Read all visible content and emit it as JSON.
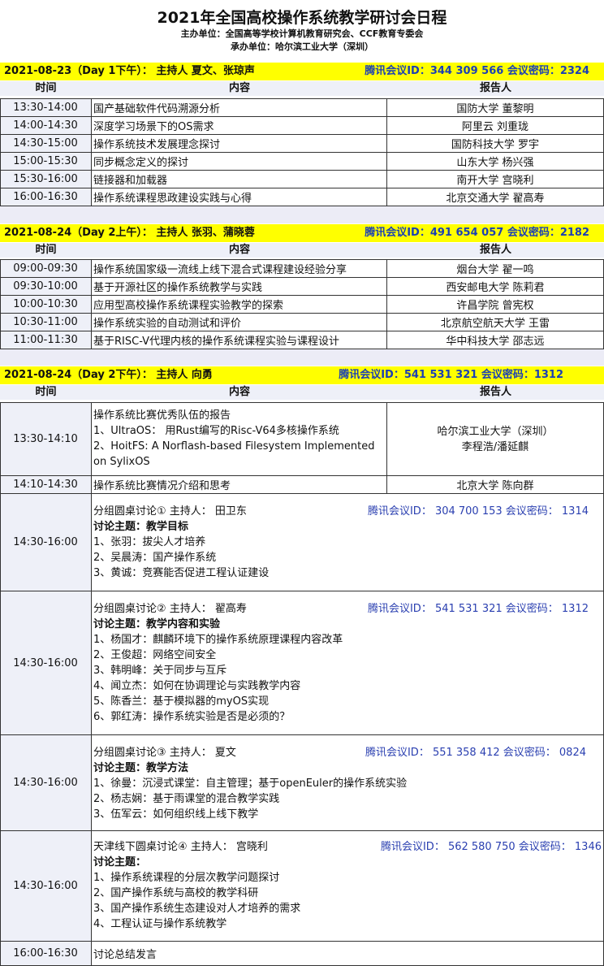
{
  "header": {
    "title": "2021年全国高校操作系统教学研讨会日程",
    "organizer": "主办单位：全国高等学校计算机教育研究会、CCF教育专委会",
    "host": "承办单位：哈尔滨工业大学（深圳）"
  },
  "columns": {
    "time": "时间",
    "content": "内容",
    "speaker": "报告人"
  },
  "sections": [
    {
      "title": "2021-08-23（Day 1下午）： 主持人 夏文、张琼声",
      "meeting": "腾讯会议ID：344 309 566  会议密码：2324",
      "rows": [
        {
          "time": "13:30-14:00",
          "content": "国产基础软件代码溯源分析",
          "speaker": "国防大学 董黎明"
        },
        {
          "time": "14:00-14:30",
          "content": "深度学习场景下的OS需求",
          "speaker": "阿里云 刘重珑"
        },
        {
          "time": "14:30-15:00",
          "content": "操作系统技术发展理念探讨",
          "speaker": "国防科技大学 罗宇"
        },
        {
          "time": "15:00-15:30",
          "content": "同步概念定义的探讨",
          "speaker": "山东大学 杨兴强"
        },
        {
          "time": "15:30-16:00",
          "content": "链接器和加载器",
          "speaker": "南开大学 宫晓利"
        },
        {
          "time": "16:00-16:30",
          "content": "操作系统课程思政建设实践与心得",
          "speaker": "北京交通大学 翟高寿"
        }
      ]
    },
    {
      "title": "2021-08-24（Day 2上午）： 主持人 张羽、蒲晓蓉",
      "meeting": "腾讯会议ID：491 654 057  会议密码：2182",
      "rows": [
        {
          "time": "09:00-09:30",
          "content": "操作系统国家级一流线上线下混合式课程建设经验分享",
          "speaker": "烟台大学 翟一鸣"
        },
        {
          "time": "09:30-10:00",
          "content": "基于开源社区的操作系统教学与实践",
          "speaker": "西安邮电大学 陈莉君"
        },
        {
          "time": "10:00-10:30",
          "content": "应用型高校操作系统课程实验教学的探索",
          "speaker": "许昌学院 曾宪权"
        },
        {
          "time": "10:30-11:00",
          "content": "操作系统实验的自动测试和评价",
          "speaker": "北京航空航天大学 王雷"
        },
        {
          "time": "11:00-11:30",
          "content": "基于RISC-V代理内核的操作系统课程实验与课程设计",
          "speaker": "华中科技大学 邵志远"
        }
      ]
    },
    {
      "title": "2021-08-24（Day 2下午）： 主持人 向勇",
      "meeting": "腾讯会议ID：541 531 321  会议密码：1312",
      "rows": [
        {
          "time": "13:30-14:10",
          "content_lines": [
            "操作系统比赛优秀队伍的报告",
            "1、UltraOS： 用Rust编写的Risc-V64多核操作系统",
            "2、HoitFS: A Norflash-based Filesystem Implemented",
            "on SylixOS"
          ],
          "speaker_lines": [
            "哈尔滨工业大学（深圳）",
            "李程浩/潘延麒"
          ]
        },
        {
          "time": "14:10-14:30",
          "content": "操作系统比赛情况介绍和思考",
          "speaker": "北京大学 陈向群"
        }
      ],
      "discussions": [
        {
          "time": "14:30-16:00",
          "head": "分组圆桌讨论① 主持人： 田卫东",
          "meeting": "腾讯会议ID： 304 700 153  会议密码： 1314",
          "topic": "讨论主题：教学目标",
          "items": [
            "1、张羽：拔尖人才培养",
            "2、吴晨涛：国产操作系统",
            "3、黄诚：竞赛能否促进工程认证建设"
          ]
        },
        {
          "time": "14:30-16:00",
          "head": "分组圆桌讨论② 主持人： 翟高寿",
          "meeting": "腾讯会议ID： 541 531 321  会议密码： 1312",
          "topic": "讨论主题：教学内容和实验",
          "items": [
            "1、杨国才：麒麟环境下的操作系统原理课程内容改革",
            "2、王俊超：网络空间安全",
            "3、韩明峰：关于同步与互斥",
            "4、闻立杰：如何在协调理论与实践教学内容",
            "5、陈香兰：基于模拟器的myOS实现",
            "6、郭红涛：操作系统实验是否是必须的？"
          ]
        },
        {
          "time": "14:30-16:00",
          "head": "分组圆桌讨论③ 主持人： 夏文",
          "meeting": "腾讯会议ID： 551 358 412  会议密码： 0824",
          "topic": "讨论主题：教学方法",
          "items": [
            "1、徐曼：沉浸式课堂：自主管理；基于openEuler的操作系统实验",
            "2、杨志娴：基于雨课堂的混合教学实践",
            "3、伍军云：如何组织线上线下教学"
          ]
        },
        {
          "time": "14:30-16:00",
          "head": "天津线下圆桌讨论④ 主持人： 宫晓利",
          "meeting": "腾讯会议ID： 562 580 750  会议密码： 1346",
          "topic": "讨论主题：",
          "items": [
            "1、操作系统课程的分层次教学问题探讨",
            "2、国产操作系统与高校的教学科研",
            "3、国产操作系统生态建设对人才培养的需求",
            "4、工程认证与操作系统教学"
          ]
        }
      ],
      "closing": {
        "time": "16:00-16:30",
        "content": "讨论总结发言"
      }
    }
  ]
}
